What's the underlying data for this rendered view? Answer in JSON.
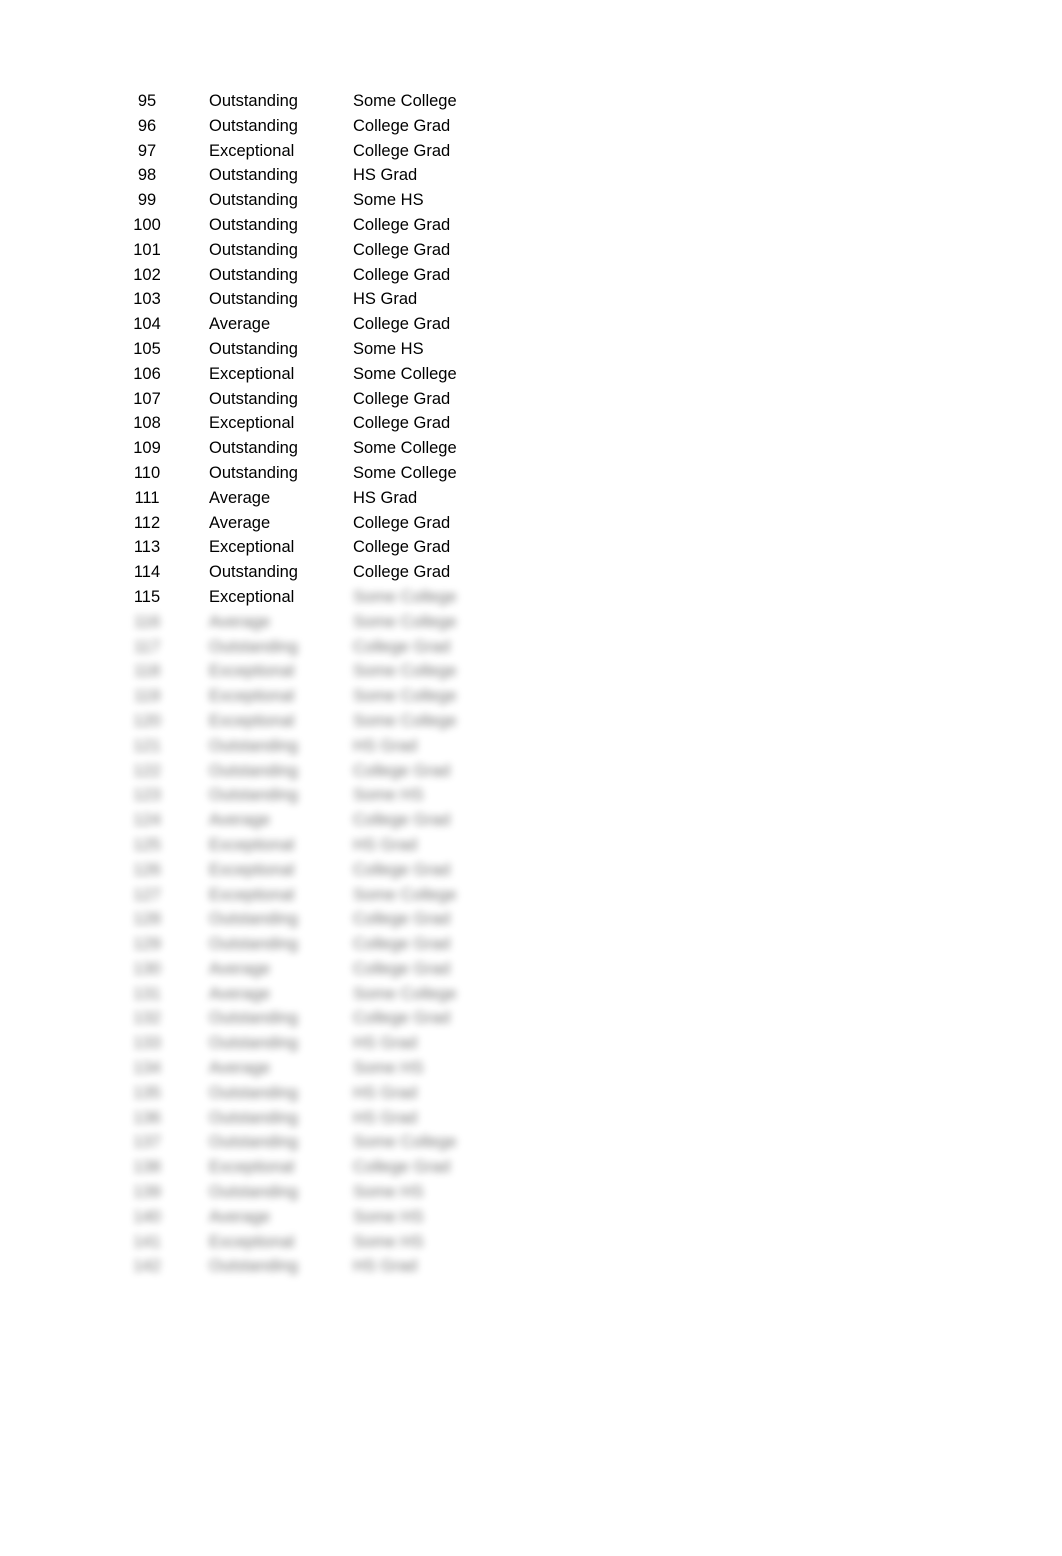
{
  "visible_rows": [
    {
      "id": "95",
      "rating": "Outstanding",
      "education": "Some College"
    },
    {
      "id": "96",
      "rating": "Outstanding",
      "education": "College Grad"
    },
    {
      "id": "97",
      "rating": "Exceptional",
      "education": "College Grad"
    },
    {
      "id": "98",
      "rating": "Outstanding",
      "education": "HS Grad"
    },
    {
      "id": "99",
      "rating": "Outstanding",
      "education": "Some HS"
    },
    {
      "id": "100",
      "rating": "Outstanding",
      "education": "College Grad"
    },
    {
      "id": "101",
      "rating": "Outstanding",
      "education": "College Grad"
    },
    {
      "id": "102",
      "rating": "Outstanding",
      "education": "College Grad"
    },
    {
      "id": "103",
      "rating": "Outstanding",
      "education": "HS Grad"
    },
    {
      "id": "104",
      "rating": "Average",
      "education": "College Grad"
    },
    {
      "id": "105",
      "rating": "Outstanding",
      "education": "Some HS"
    },
    {
      "id": "106",
      "rating": "Exceptional",
      "education": "Some College"
    },
    {
      "id": "107",
      "rating": "Outstanding",
      "education": "College Grad"
    },
    {
      "id": "108",
      "rating": "Exceptional",
      "education": "College Grad"
    },
    {
      "id": "109",
      "rating": "Outstanding",
      "education": "Some College"
    },
    {
      "id": "110",
      "rating": "Outstanding",
      "education": "Some College"
    },
    {
      "id": "111",
      "rating": "Average",
      "education": "HS Grad"
    },
    {
      "id": "112",
      "rating": "Average",
      "education": "College Grad"
    },
    {
      "id": "113",
      "rating": "Exceptional",
      "education": "College Grad"
    },
    {
      "id": "114",
      "rating": "Outstanding",
      "education": "College Grad"
    },
    {
      "id": "115",
      "rating": "Exceptional",
      "education": "Some College"
    }
  ],
  "blurred_rows": [
    {
      "id": "116",
      "rating": "Average",
      "education": "Some College"
    },
    {
      "id": "117",
      "rating": "Outstanding",
      "education": "College Grad"
    },
    {
      "id": "118",
      "rating": "Exceptional",
      "education": "Some College"
    },
    {
      "id": "119",
      "rating": "Exceptional",
      "education": "Some College"
    },
    {
      "id": "120",
      "rating": "Exceptional",
      "education": "Some College"
    },
    {
      "id": "121",
      "rating": "Outstanding",
      "education": "HS Grad"
    },
    {
      "id": "122",
      "rating": "Outstanding",
      "education": "College Grad"
    },
    {
      "id": "123",
      "rating": "Outstanding",
      "education": "Some HS"
    },
    {
      "id": "124",
      "rating": "Average",
      "education": "College Grad"
    },
    {
      "id": "125",
      "rating": "Exceptional",
      "education": "HS Grad"
    },
    {
      "id": "126",
      "rating": "Exceptional",
      "education": "College Grad"
    },
    {
      "id": "127",
      "rating": "Exceptional",
      "education": "Some College"
    },
    {
      "id": "128",
      "rating": "Outstanding",
      "education": "College Grad"
    },
    {
      "id": "129",
      "rating": "Outstanding",
      "education": "College Grad"
    },
    {
      "id": "130",
      "rating": "Average",
      "education": "College Grad"
    },
    {
      "id": "131",
      "rating": "Average",
      "education": "Some College"
    },
    {
      "id": "132",
      "rating": "Outstanding",
      "education": "College Grad"
    },
    {
      "id": "133",
      "rating": "Outstanding",
      "education": "HS Grad"
    },
    {
      "id": "134",
      "rating": "Average",
      "education": "Some HS"
    },
    {
      "id": "135",
      "rating": "Outstanding",
      "education": "HS Grad"
    },
    {
      "id": "136",
      "rating": "Outstanding",
      "education": "HS Grad"
    },
    {
      "id": "137",
      "rating": "Outstanding",
      "education": "Some College"
    },
    {
      "id": "138",
      "rating": "Exceptional",
      "education": "College Grad"
    },
    {
      "id": "139",
      "rating": "Outstanding",
      "education": "Some HS"
    },
    {
      "id": "140",
      "rating": "Average",
      "education": "Some HS"
    },
    {
      "id": "141",
      "rating": "Exceptional",
      "education": "Some HS"
    },
    {
      "id": "142",
      "rating": "Outstanding",
      "education": "HS Grad"
    }
  ]
}
